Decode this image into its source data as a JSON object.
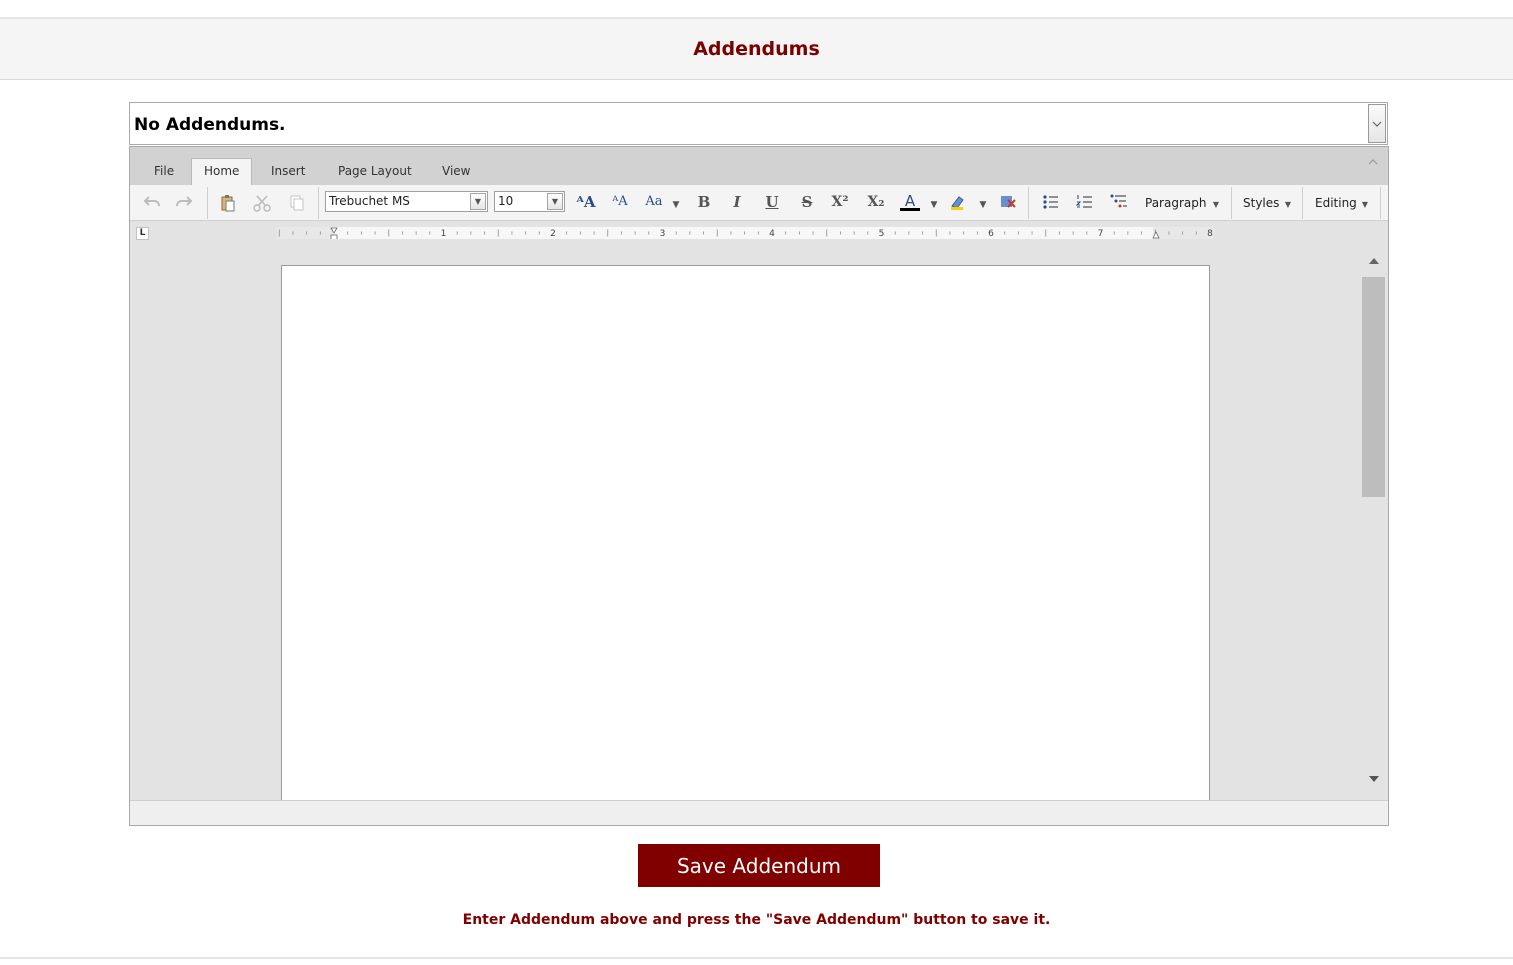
{
  "header": {
    "title": "Addendums"
  },
  "addendum_select": {
    "value": "No Addendums."
  },
  "editor": {
    "tabs": [
      "File",
      "Home",
      "Insert",
      "Page Layout",
      "View"
    ],
    "active_tab": "Home",
    "font_name": "Trebuchet MS",
    "font_size": "10",
    "toolbar": {
      "grow_font": "ᴬA",
      "shrink_font": "ᴬA",
      "change_case": "Aa",
      "bold": "B",
      "italic": "I",
      "underline": "U",
      "strikethrough": "S",
      "superscript": "X²",
      "subscript": "X₂",
      "font_color": "A",
      "paragraph_label": "Paragraph",
      "styles_label": "Styles",
      "editing_label": "Editing"
    },
    "ruler_numbers": [
      "1",
      "2",
      "3",
      "4",
      "5",
      "6",
      "7",
      "8"
    ],
    "tab_stop_glyph": "L"
  },
  "save_button": {
    "label": "Save Addendum"
  },
  "help_text": "Enter Addendum above and press the \"Save Addendum\" button to save it.",
  "colors": {
    "accent": "#800000",
    "header_text": "#7b0000"
  }
}
